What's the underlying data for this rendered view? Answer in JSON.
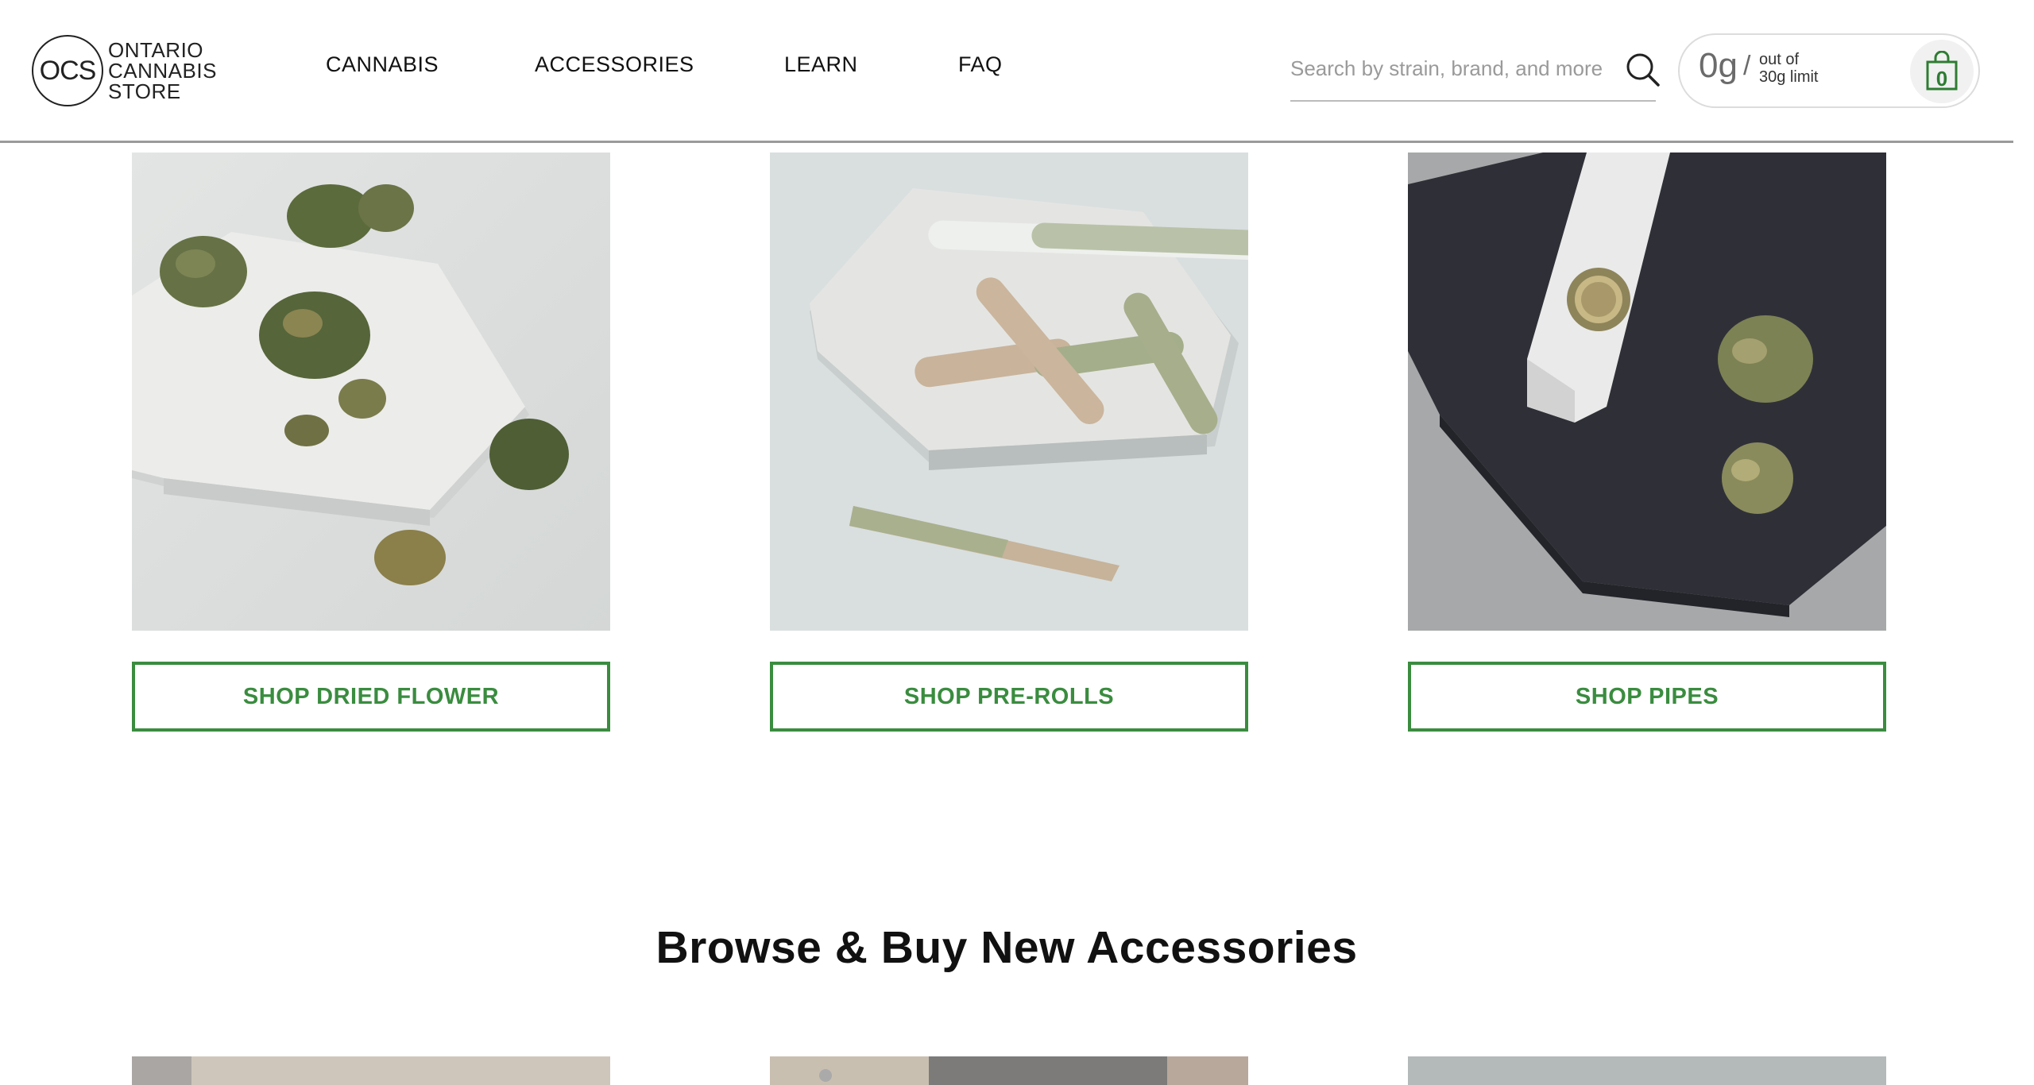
{
  "logo": {
    "mark": "OCS",
    "line1": "ONTARIO",
    "line2": "CANNABIS",
    "line3": "STORE"
  },
  "nav": {
    "items": [
      {
        "label": "CANNABIS"
      },
      {
        "label": "ACCESSORIES"
      },
      {
        "label": "LEARN"
      },
      {
        "label": "FAQ"
      }
    ]
  },
  "search": {
    "placeholder": "Search by strain, brand, and more",
    "icon": "search-icon"
  },
  "limit": {
    "amount": "0g",
    "separator": "/",
    "line1": "out of",
    "line2": "30g limit"
  },
  "cart": {
    "count": "0",
    "icon": "shopping-bag-icon"
  },
  "tiles": [
    {
      "button": "SHOP DRIED FLOWER",
      "image": "dried-flower-image"
    },
    {
      "button": "SHOP PRE-ROLLS",
      "image": "pre-rolls-image"
    },
    {
      "button": "SHOP PIPES",
      "image": "pipes-image"
    }
  ],
  "section": {
    "title": "Browse & Buy New Accessories"
  },
  "colors": {
    "accent_green": "#3a8c3f",
    "header_border": "#9a9a9a"
  }
}
